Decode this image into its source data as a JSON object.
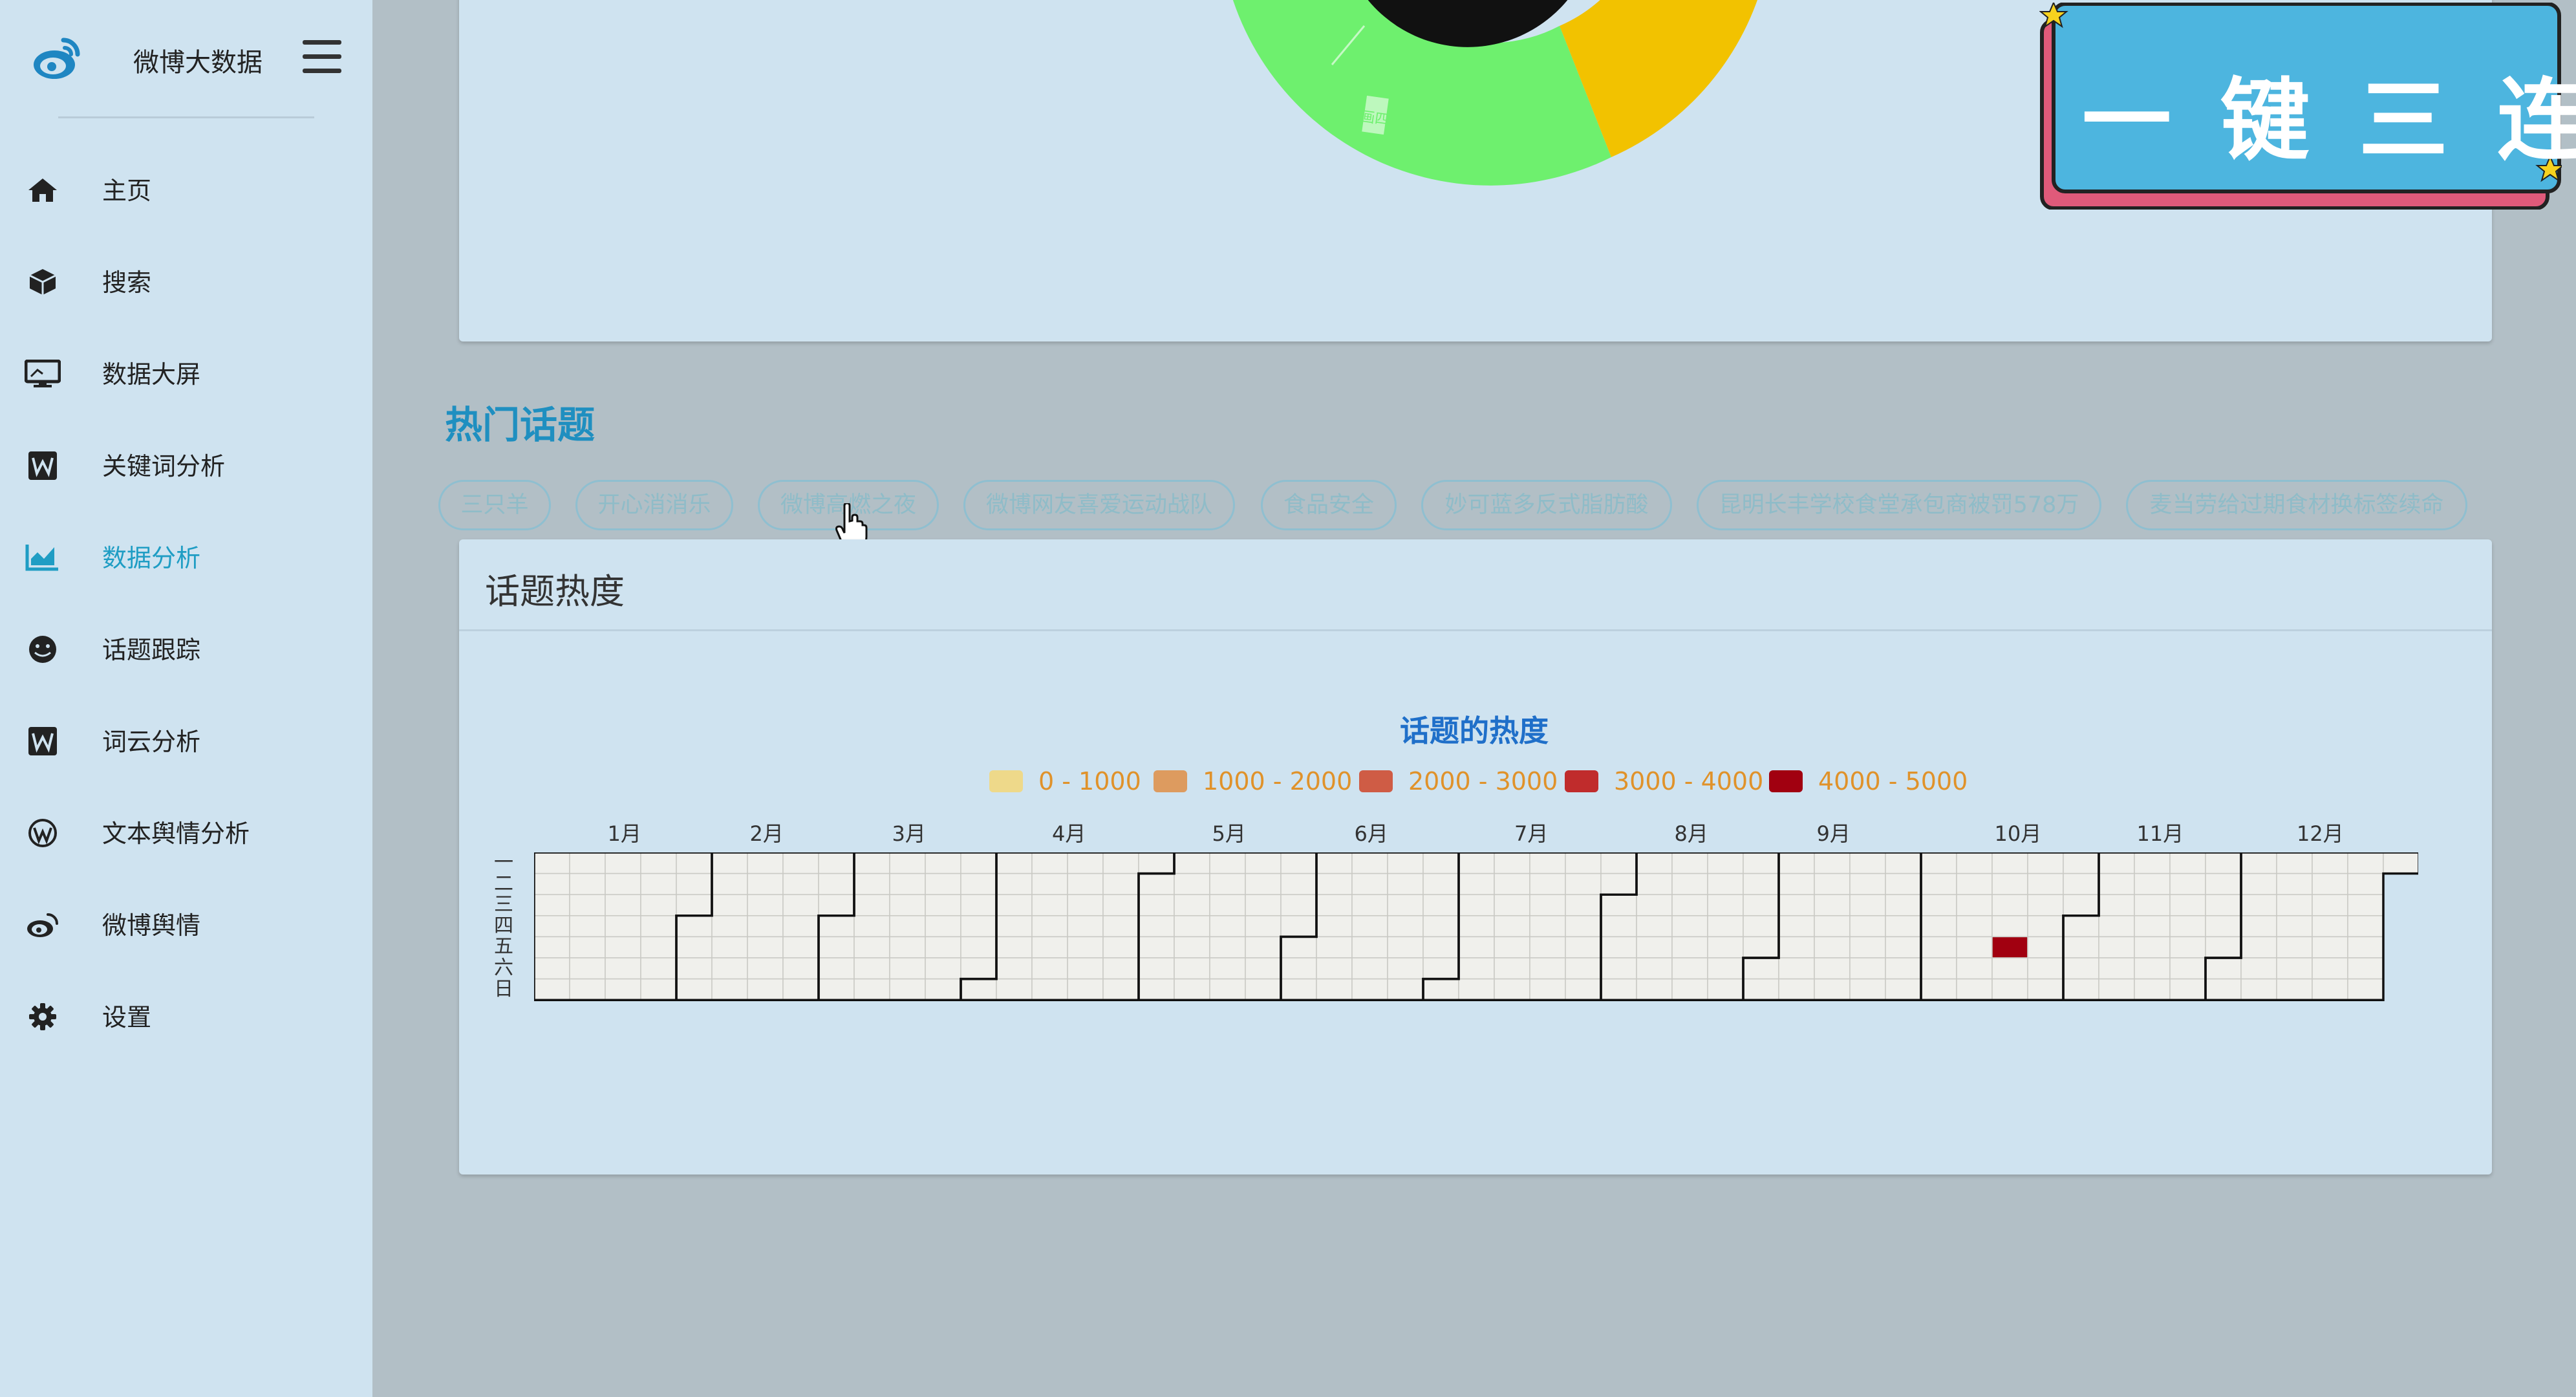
{
  "app": {
    "brand_name": "微博大数据"
  },
  "sidebar": {
    "items": [
      {
        "label": "主页",
        "icon": "home-icon",
        "active": false
      },
      {
        "label": "搜索",
        "icon": "cube-icon",
        "active": false
      },
      {
        "label": "数据大屏",
        "icon": "monitor-icon",
        "active": false
      },
      {
        "label": "关键词分析",
        "icon": "word-icon",
        "active": false
      },
      {
        "label": "数据分析",
        "icon": "chart-line-icon",
        "active": true
      },
      {
        "label": "话题跟踪",
        "icon": "smile-icon",
        "active": false
      },
      {
        "label": "词云分析",
        "icon": "word-icon",
        "active": false
      },
      {
        "label": "文本舆情分析",
        "icon": "wordpress-icon",
        "active": false
      },
      {
        "label": "微博舆情",
        "icon": "weibo-icon",
        "active": false
      },
      {
        "label": "设置",
        "icon": "gear-icon",
        "active": false
      }
    ]
  },
  "hot_topics": {
    "title": "热门话题",
    "chips": [
      "三只羊",
      "开心消消乐",
      "微博高燃之夜",
      "微博网友喜爱运动战队",
      "食品安全",
      "妙可蓝多反式脂肪酸",
      "昆明长丰学校食堂承包商被罚578万",
      "麦当劳给过期食材换标签续命"
    ]
  },
  "heat_card": {
    "title": "话题热度",
    "pie_segment_label": "画四"
  },
  "chart_data": {
    "type": "heatmap",
    "title": "话题的热度",
    "legend": [
      {
        "label": "0 - 1000",
        "color": "#eed98a"
      },
      {
        "label": "1000 - 2000",
        "color": "#dd9b5f"
      },
      {
        "label": "2000 - 3000",
        "color": "#cf5c45"
      },
      {
        "label": "3000 - 4000",
        "color": "#c02c2c"
      },
      {
        "label": "4000 - 5000",
        "color": "#a10010"
      }
    ],
    "months": [
      "1月",
      "2月",
      "3月",
      "4月",
      "5月",
      "6月",
      "7月",
      "8月",
      "9月",
      "10月",
      "11月",
      "12月"
    ],
    "weekdays": [
      "一",
      "二",
      "三",
      "四",
      "五",
      "六",
      "日"
    ],
    "weeks": 53,
    "cells": [
      {
        "week": 41,
        "day": 4,
        "value": 4500
      }
    ]
  },
  "overlay": {
    "text": "一键三连"
  },
  "colors": {
    "accent": "#1f9dc4",
    "pie_green": "#6ef06e",
    "pie_yellow": "#f2c200",
    "badge_blue": "#4db5df",
    "badge_pink": "#e05a7a"
  }
}
